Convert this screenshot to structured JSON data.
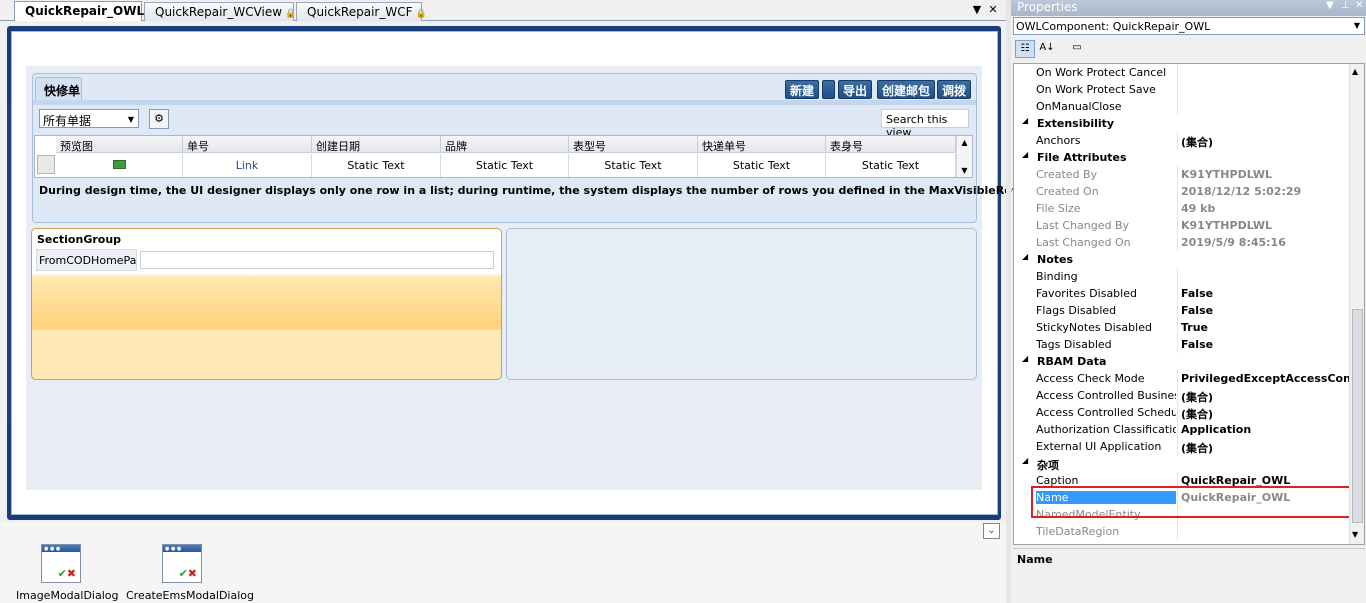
{
  "tabs": [
    {
      "label": "QuickRepair_OWL",
      "active": true,
      "locked": false
    },
    {
      "label": "QuickRepair_WCView",
      "active": false,
      "locked": true
    },
    {
      "label": "QuickRepair_WCF",
      "active": false,
      "locked": true
    }
  ],
  "tab_controls": {
    "dropdown": "▼",
    "close": "✕"
  },
  "designer": {
    "panel_tab": "快修单",
    "toolbar_buttons": [
      "新建",
      "",
      "导出",
      "创建邮包",
      "调拨"
    ],
    "filter_value": "所有单据",
    "search_view": "Search this view",
    "grid_headers": [
      "预览图",
      "单号",
      "创建日期",
      "品牌",
      "表型号",
      "快递单号",
      "表身号"
    ],
    "grid_cells": [
      "",
      "Link",
      "Static Text",
      "Static Text",
      "Static Text",
      "Static Text",
      "Static Text"
    ],
    "design_note": "During design time, the UI designer displays only one row in a list; during runtime, the system displays the number of rows you defined in the MaxVisibleRows property.",
    "section_group": {
      "title": "SectionGroup",
      "field_label": "FromCODHomePage"
    }
  },
  "tray": {
    "items": [
      "ImageModalDialog",
      "CreateEmsModalDialog"
    ]
  },
  "properties": {
    "title": "Properties",
    "object": "OWLComponent: QuickRepair_OWL",
    "rows": [
      {
        "name": "On Work Protect Cancel",
        "value": "",
        "kind": "prop"
      },
      {
        "name": "On Work Protect Save",
        "value": "",
        "kind": "prop"
      },
      {
        "name": "OnManualClose",
        "value": "",
        "kind": "prop"
      },
      {
        "name": "Extensibility",
        "value": "",
        "kind": "cat"
      },
      {
        "name": "Anchors",
        "value": "(集合)",
        "kind": "prop"
      },
      {
        "name": "File Attributes",
        "value": "",
        "kind": "cat"
      },
      {
        "name": "Created By",
        "value": "K91YTHPDLWL",
        "kind": "grey"
      },
      {
        "name": "Created On",
        "value": "2018/12/12 5:02:29",
        "kind": "grey"
      },
      {
        "name": "File Size",
        "value": "49 kb",
        "kind": "grey"
      },
      {
        "name": "Last Changed By",
        "value": "K91YTHPDLWL",
        "kind": "grey"
      },
      {
        "name": "Last Changed On",
        "value": "2019/5/9 8:45:16",
        "kind": "grey"
      },
      {
        "name": "Notes",
        "value": "",
        "kind": "cat"
      },
      {
        "name": "Binding",
        "value": "",
        "kind": "prop"
      },
      {
        "name": "Favorites Disabled",
        "value": "False",
        "kind": "prop"
      },
      {
        "name": "Flags Disabled",
        "value": "False",
        "kind": "prop"
      },
      {
        "name": "StickyNotes Disabled",
        "value": "True",
        "kind": "prop"
      },
      {
        "name": "Tags Disabled",
        "value": "False",
        "kind": "prop"
      },
      {
        "name": "RBAM Data",
        "value": "",
        "kind": "cat"
      },
      {
        "name": "Access Check Mode",
        "value": "PrivilegedExceptAccessControl",
        "kind": "prop"
      },
      {
        "name": "Access Controlled Business",
        "value": "(集合)",
        "kind": "prop"
      },
      {
        "name": "Access Controlled Schedule",
        "value": "(集合)",
        "kind": "prop"
      },
      {
        "name": "Authorization Classification",
        "value": "Application",
        "kind": "prop"
      },
      {
        "name": "External UI Application",
        "value": "(集合)",
        "kind": "prop"
      },
      {
        "name": "杂项",
        "value": "",
        "kind": "cat"
      },
      {
        "name": "Caption",
        "value": "QuickRepair_OWL",
        "kind": "prop"
      },
      {
        "name": "Name",
        "value": "QuickRepair_OWL",
        "kind": "selected"
      },
      {
        "name": "NamedModelEntity",
        "value": "",
        "kind": "grey"
      },
      {
        "name": "TileDataRegion",
        "value": "",
        "kind": "grey"
      }
    ],
    "description_title": "Name"
  }
}
